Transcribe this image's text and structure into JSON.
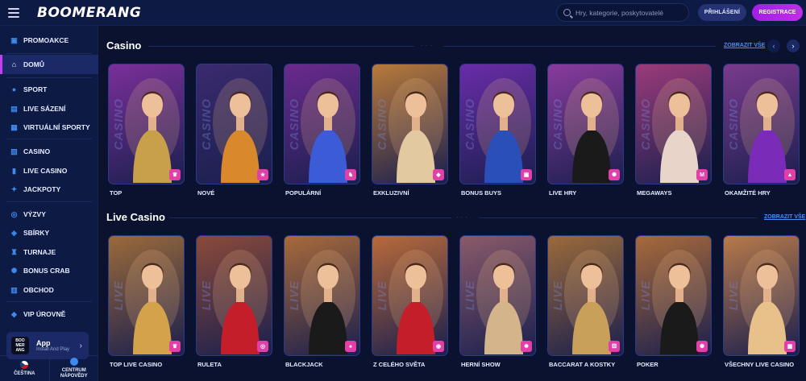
{
  "header": {
    "logo": "BOOMERANG",
    "search_placeholder": "Hry, kategorie, poskytovatelé",
    "login_label": "PŘIHLÁŠENÍ",
    "register_label": "REGISTRACE"
  },
  "sidebar": {
    "items": [
      {
        "label": "PROMOAKCE",
        "icon": "gift-icon"
      },
      {
        "label": "DOMŮ",
        "icon": "home-icon"
      },
      {
        "label": "SPORT",
        "icon": "ball-icon"
      },
      {
        "label": "LIVE SÁZENÍ",
        "icon": "live-icon"
      },
      {
        "label": "VIRTUÁLNÍ SPORTY",
        "icon": "virtual-icon"
      },
      {
        "label": "CASINO",
        "icon": "cards-icon"
      },
      {
        "label": "LIVE CASINO",
        "icon": "live-casino-icon"
      },
      {
        "label": "JACKPOTY",
        "icon": "jackpot-icon"
      },
      {
        "label": "VÝZVY",
        "icon": "challenge-icon"
      },
      {
        "label": "SBÍRKY",
        "icon": "collection-icon"
      },
      {
        "label": "TURNAJE",
        "icon": "trophy-icon"
      },
      {
        "label": "BONUS CRAB",
        "icon": "crab-icon"
      },
      {
        "label": "OBCHOD",
        "icon": "shop-icon"
      },
      {
        "label": "VIP ÚROVNĚ",
        "icon": "diamond-icon"
      }
    ],
    "app": {
      "logo_text": "BOO MER ANG",
      "title": "App",
      "subtitle": "Install And Play"
    },
    "language": "ČEŠTINA",
    "help": "CENTRUM NÁPOVĚDY"
  },
  "casino": {
    "title": "Casino",
    "show_all": "ZOBRAZIT VŠE",
    "side_text": "CASINO",
    "cards": [
      {
        "label": "TOP",
        "badge": "crown-icon",
        "bg": "#7a2f9a",
        "accent": "#c8a04a"
      },
      {
        "label": "NOVÉ",
        "badge": "star-icon",
        "bg": "#3a2a6e",
        "accent": "#d9892c"
      },
      {
        "label": "POPULÁRNÍ",
        "badge": "bag-icon",
        "bg": "#6b2a8e",
        "accent": "#3b5cd6"
      },
      {
        "label": "EXKLUZIVNÍ",
        "badge": "diamond-icon",
        "bg": "#b87a3a",
        "accent": "#e2c9a0"
      },
      {
        "label": "BONUS BUYS",
        "badge": "gift-icon",
        "bg": "#6a2ca8",
        "accent": "#2a4fb8"
      },
      {
        "label": "LIVE HRY",
        "badge": "chip-icon",
        "bg": "#8a3b9e",
        "accent": "#1a1a1a"
      },
      {
        "label": "MEGAWAYS",
        "badge": "m-icon",
        "bg": "#9a3b7a",
        "accent": "#e8d4c8"
      },
      {
        "label": "OKAMŽITÉ HRY",
        "badge": "person-icon",
        "bg": "#7a3a8e",
        "accent": "#7a2bb8"
      }
    ]
  },
  "live_casino": {
    "title": "Live Casino",
    "show_all": "ZOBRAZIT VŠE",
    "side_text": "LIVE",
    "cards": [
      {
        "label": "TOP LIVE CASINO",
        "badge": "crown-icon",
        "bg": "#9a6a3a",
        "accent": "#d4a24a"
      },
      {
        "label": "RULETA",
        "badge": "roulette-icon",
        "bg": "#8a4a3a",
        "accent": "#c41e2a"
      },
      {
        "label": "BLACKJACK",
        "badge": "cards-icon",
        "bg": "#a86a3a",
        "accent": "#1a1a1a"
      },
      {
        "label": "Z CELÉHO SVĚTA",
        "badge": "globe-icon",
        "bg": "#b86a3a",
        "accent": "#c41e2a"
      },
      {
        "label": "HERNÍ SHOW",
        "badge": "wheel-icon",
        "bg": "#8a5a6a",
        "accent": "#d4b48a"
      },
      {
        "label": "BACCARAT A KOSTKY",
        "badge": "dice-icon",
        "bg": "#9a6a3a",
        "accent": "#c8a05a"
      },
      {
        "label": "POKER",
        "badge": "chip-icon",
        "bg": "#a86a3a",
        "accent": "#1a1a1a"
      },
      {
        "label": "VŠECHNY LIVE CASINO",
        "badge": "grid-icon",
        "bg": "#b87a4a",
        "accent": "#e8c08a"
      }
    ]
  }
}
